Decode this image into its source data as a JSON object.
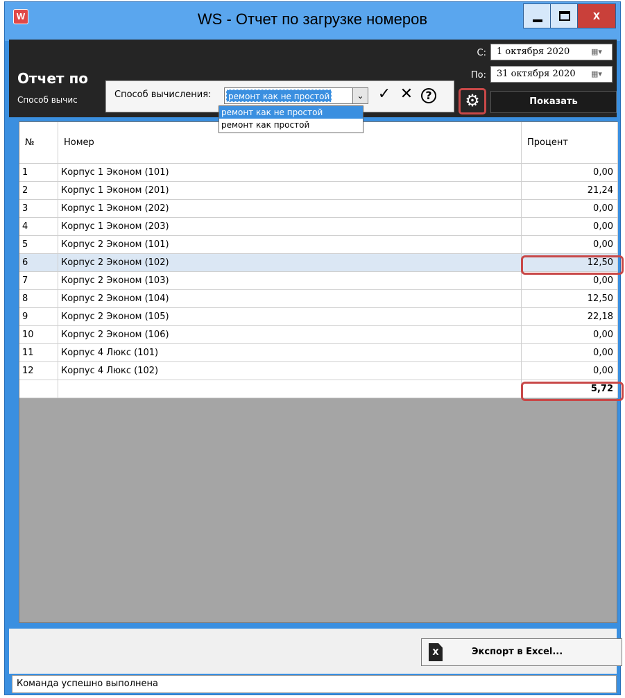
{
  "window": {
    "title": "WS - Отчет по загрузке номеров",
    "icon_label": "W",
    "close_label": "x"
  },
  "header": {
    "report_title": "Отчет по",
    "method_label": "Способ вычис",
    "from_label": "С:",
    "from_date": "1 октября 2020",
    "to_label": "По:",
    "to_date": "31 октября 2020",
    "show_button": "Показать",
    "calendar_glyph": "▦▾"
  },
  "popup": {
    "label": "Способ вычисления:",
    "selected": "ремонт как не простой",
    "options": [
      "ремонт как не простой",
      "ремонт как простой"
    ],
    "confirm_glyph": "✓",
    "cancel_glyph": "✕",
    "help_glyph": "?",
    "gear_glyph": "⚙",
    "dropdown_glyph": "⌄"
  },
  "table": {
    "columns": [
      "№",
      "Номер",
      "Процент"
    ],
    "rows": [
      {
        "n": "1",
        "name": "Корпус 1 Эконом (101)",
        "pct": "0,00"
      },
      {
        "n": "2",
        "name": "Корпус 1 Эконом (201)",
        "pct": "21,24"
      },
      {
        "n": "3",
        "name": "Корпус 1 Эконом (202)",
        "pct": "0,00"
      },
      {
        "n": "4",
        "name": "Корпус 1 Эконом (203)",
        "pct": "0,00"
      },
      {
        "n": "5",
        "name": "Корпус 2 Эконом (101)",
        "pct": "0,00"
      },
      {
        "n": "6",
        "name": "Корпус 2 Эконом (102)",
        "pct": "12,50"
      },
      {
        "n": "7",
        "name": "Корпус 2 Эконом (103)",
        "pct": "0,00"
      },
      {
        "n": "8",
        "name": "Корпус 2 Эконом (104)",
        "pct": "12,50"
      },
      {
        "n": "9",
        "name": "Корпус 2 Эконом (105)",
        "pct": "22,18"
      },
      {
        "n": "10",
        "name": "Корпус 2 Эконом (106)",
        "pct": "0,00"
      },
      {
        "n": "11",
        "name": "Корпус 4 Люкс (101)",
        "pct": "0,00"
      },
      {
        "n": "12",
        "name": "Корпус 4 Люкс (102)",
        "pct": "0,00"
      }
    ],
    "total": "5,72",
    "highlighted_row_index": 5
  },
  "footer": {
    "export_button": "Экспорт в Excel...",
    "export_icon_glyph": "X",
    "status": "Команда успешно выполнена"
  },
  "colors": {
    "accent": "#3a8fe0",
    "header_bg": "#252525",
    "highlight_border": "#c84848",
    "selected_row": "#dbe7f4"
  }
}
